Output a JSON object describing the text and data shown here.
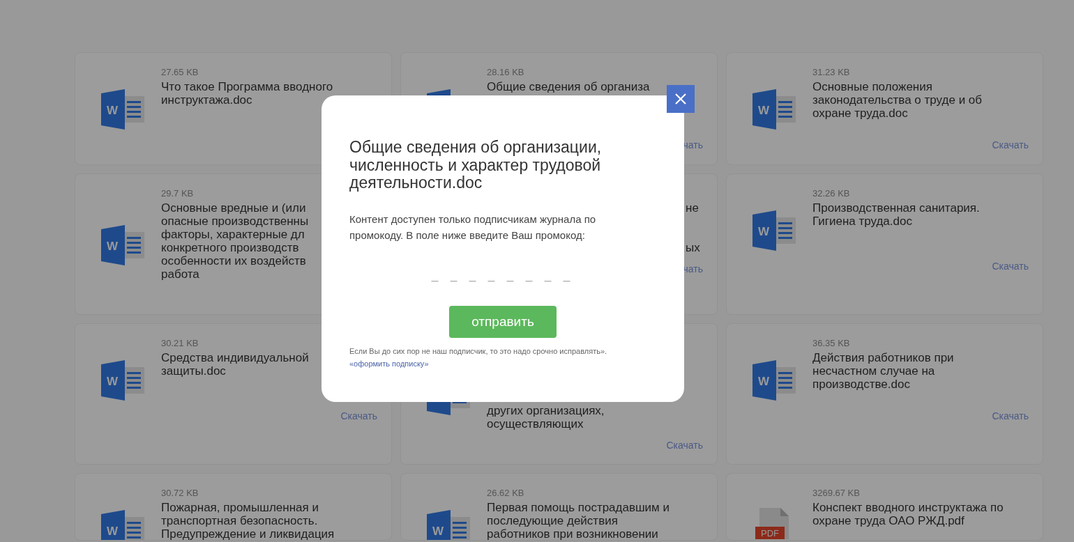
{
  "cards": [
    {
      "kind": "word",
      "icon_label": "W",
      "size": "27.65 KB",
      "title_lines": [
        {
          "kind": "head",
          "text": "Что такое Программа вводного"
        },
        {
          "kind": "head",
          "text": "инструктажа.doc"
        }
      ]
    },
    {
      "kind": "word",
      "size": "28.16 KB",
      "title_lines": [
        {
          "kind": "head",
          "text": "Общие сведения об организа"
        }
      ],
      "download": "чать"
    },
    {
      "kind": "word",
      "icon_label": "W",
      "size": "31.23 KB",
      "title_lines": [
        {
          "kind": "head",
          "text": "Основные положения"
        },
        {
          "kind": "head",
          "text": "законодательства о труде и об"
        },
        {
          "kind": "head",
          "text": "охране труда.doc"
        }
      ],
      "download": "Скачать"
    },
    {
      "kind": "word",
      "icon_label": "W",
      "size": "29.7 KB",
      "title_lines": [
        {
          "kind": "head",
          "text": "Основные вредные и (или"
        },
        {
          "kind": "head",
          "text": "опасные производственны"
        },
        {
          "kind": "head",
          "text": "факторы, характерные дл"
        },
        {
          "kind": "head",
          "text": "конкретного производств"
        },
        {
          "kind": "head",
          "text": "особенности их воздейств"
        },
        {
          "kind": "head",
          "text": "работа"
        }
      ]
    },
    {
      "kind": "covered",
      "title_lines": [
        {
          "kind": "tail",
          "text": "не"
        },
        {
          "kind": "gap"
        },
        {
          "kind": "gap"
        },
        {
          "kind": "tail",
          "text": "ых"
        }
      ],
      "download": "чать"
    },
    {
      "kind": "word",
      "icon_label": "W",
      "size": "32.26 KB",
      "title_lines": [
        {
          "kind": "head",
          "text": "Производственная санитария."
        },
        {
          "kind": "head",
          "text": "Гигиена труда.doc"
        }
      ],
      "download": "Скачать"
    },
    {
      "kind": "word",
      "icon_label": "W",
      "size": "30.21 KB",
      "title_lines": [
        {
          "kind": "head",
          "text": "Средства индивидуальной"
        },
        {
          "kind": "head",
          "text": "защиты.doc"
        }
      ],
      "download": "Скачать"
    },
    {
      "kind": "word",
      "title_lines": [
        {
          "kind": "gap"
        },
        {
          "kind": "gap"
        },
        {
          "kind": "gap"
        },
        {
          "kind": "gap"
        },
        {
          "kind": "head",
          "text": "других организациях,"
        },
        {
          "kind": "head",
          "text": "осуществляющих"
        }
      ],
      "download": "Скачать"
    },
    {
      "kind": "word",
      "icon_label": "W",
      "size": "36.35 KB",
      "title_lines": [
        {
          "kind": "head",
          "text": "Действия работников при"
        },
        {
          "kind": "head",
          "text": "несчастном случае на"
        },
        {
          "kind": "head",
          "text": "производстве.doc"
        }
      ],
      "download": "Скачать"
    },
    {
      "kind": "word",
      "icon_label": "W",
      "size": "30.72 KB",
      "title_lines": [
        {
          "kind": "head",
          "text": "Пожарная, промышленная и"
        },
        {
          "kind": "head",
          "text": "транспортная безопасность."
        },
        {
          "kind": "head",
          "text": "Предупреждение и ликвидация"
        }
      ]
    },
    {
      "kind": "word",
      "icon_label": "W",
      "size": "26.62 KB",
      "title_lines": [
        {
          "kind": "head",
          "text": "Первая помощь пострадавшим и"
        },
        {
          "kind": "head",
          "text": "последующие действия"
        },
        {
          "kind": "head",
          "text": "работников при возникновении"
        }
      ]
    },
    {
      "kind": "pdf",
      "icon_label": "PDF",
      "size": "3269.67 KB",
      "title_lines": [
        {
          "kind": "head",
          "text": "Конспект вводного инструктажа по"
        },
        {
          "kind": "head",
          "text": "охране труда ОАО РЖД.pdf"
        }
      ]
    }
  ],
  "modal": {
    "title_lines": [
      "Общие сведения об организации,",
      "численность и характер трудовой",
      "деятельности.doc"
    ],
    "message_lines": [
      "Контент доступен только подписчикам журнала по",
      "промокоду. В поле ниже введите Ваш промокод:"
    ],
    "code_field": {
      "placeholder": "– – – – – – – –"
    },
    "submit_button": "отправить",
    "note": "Если Вы до сих пор не наш подписчик, то это надо срочно исправлять».",
    "subscribe_link": "«оформить подписку»",
    "close_button": true
  }
}
